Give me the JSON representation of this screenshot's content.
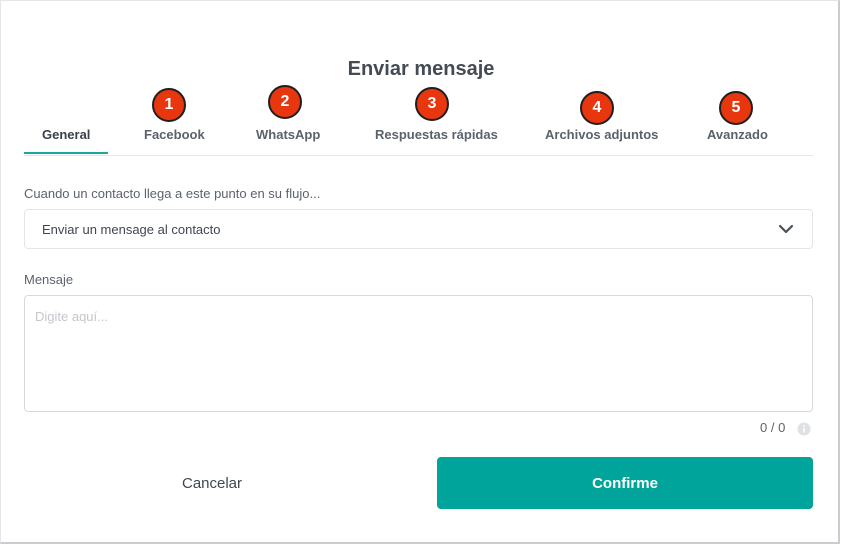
{
  "dialog": {
    "title": "Enviar mensaje"
  },
  "tabs": [
    {
      "label": "General",
      "active": true
    },
    {
      "label": "Facebook",
      "badge": "1"
    },
    {
      "label": "WhatsApp",
      "badge": "2"
    },
    {
      "label": "Respuestas rápidas",
      "badge": "3"
    },
    {
      "label": "Archivos adjuntos",
      "badge": "4"
    },
    {
      "label": "Avanzado",
      "badge": "5"
    }
  ],
  "trigger": {
    "label": "Cuando un contacto llega a este punto en su flujo...",
    "selected_value": "Enviar un mensage al contacto",
    "icon": "chevron-down-icon"
  },
  "message": {
    "label": "Mensaje",
    "placeholder": "Digite aquí...",
    "value": "",
    "counter": "0 / 0",
    "info_icon": "info-icon"
  },
  "actions": {
    "cancel_label": "Cancelar",
    "confirm_label": "Confirme"
  },
  "colors": {
    "accent": "#00a49a",
    "badge": "#e8360f",
    "tab_underline": "#1ba79c"
  }
}
